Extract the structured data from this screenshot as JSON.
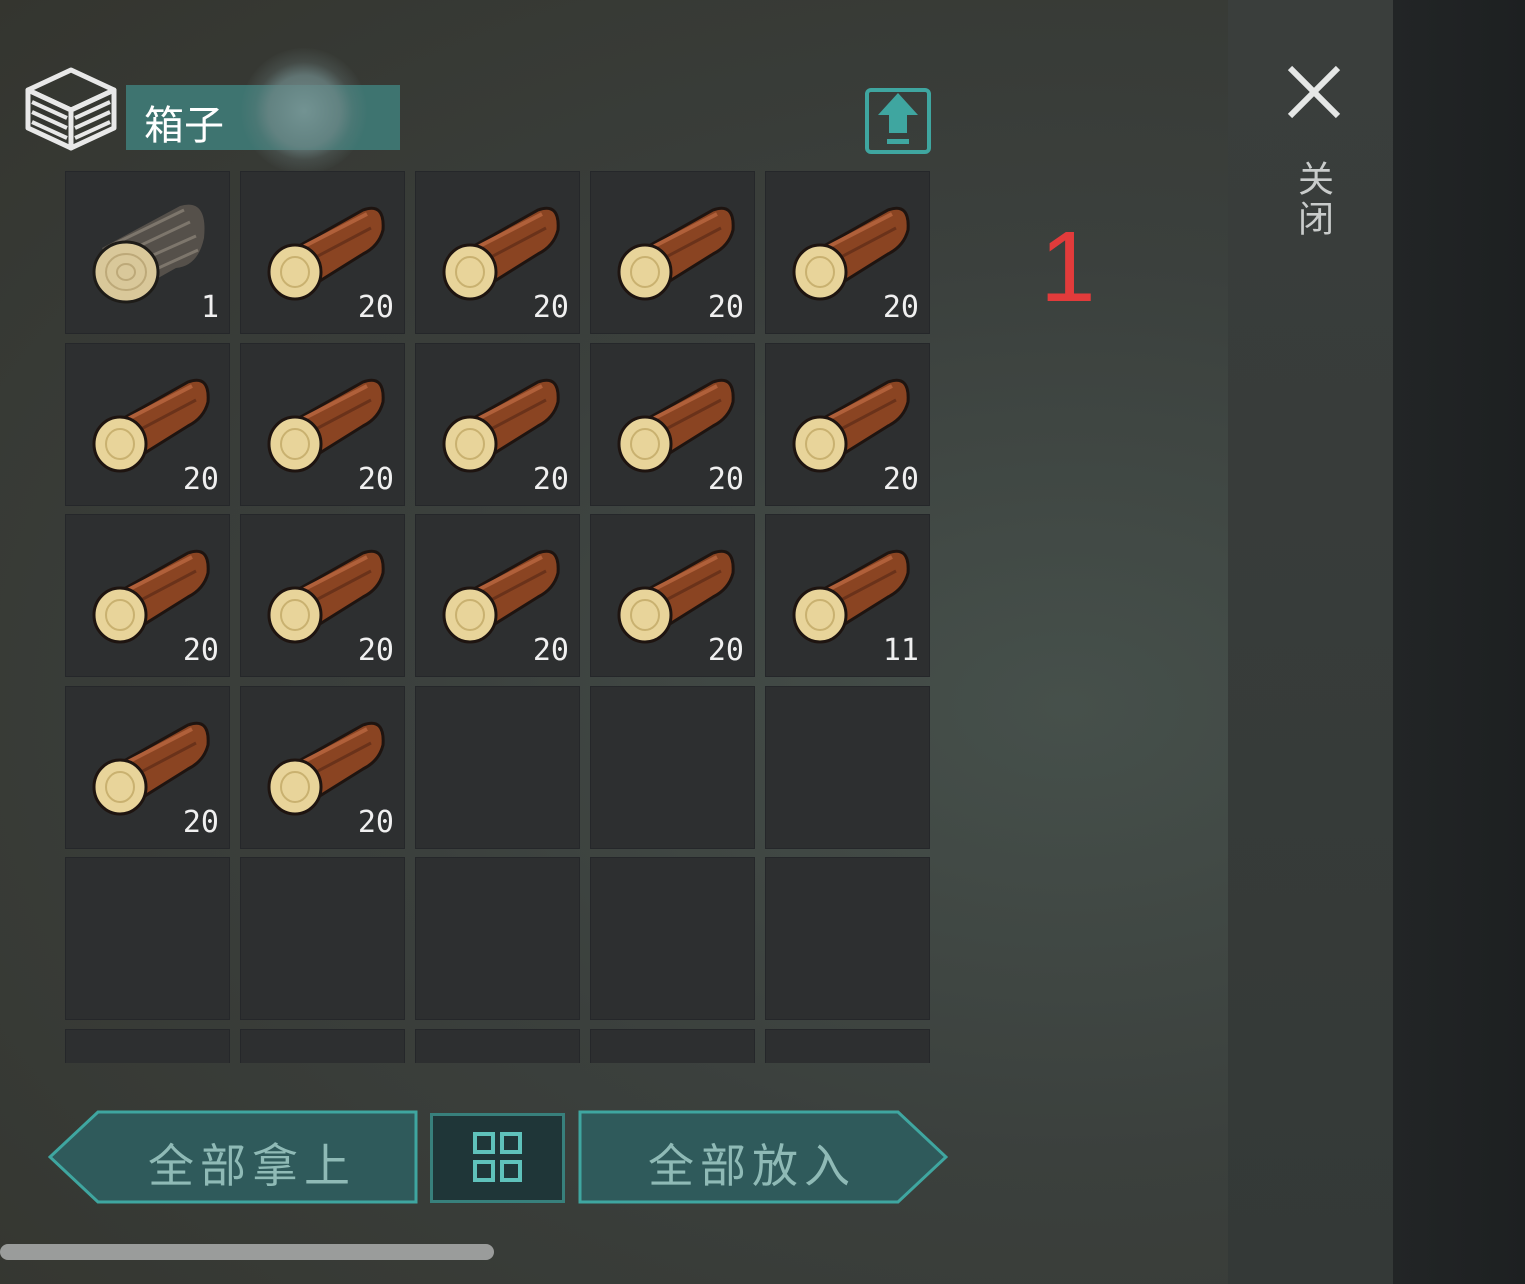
{
  "header": {
    "title": "箱子",
    "box_icon": "storage-box-icon",
    "export_icon": "upload-arrow-icon"
  },
  "sidebar": {
    "close_label": "关闭",
    "close_icon": "close-x-icon"
  },
  "annotation": "1",
  "inventory": {
    "columns": 5,
    "slots": [
      {
        "item": "log",
        "qty": "1"
      },
      {
        "item": "wood",
        "qty": "20"
      },
      {
        "item": "wood",
        "qty": "20"
      },
      {
        "item": "wood",
        "qty": "20"
      },
      {
        "item": "wood",
        "qty": "20"
      },
      {
        "item": "wood",
        "qty": "20"
      },
      {
        "item": "wood",
        "qty": "20"
      },
      {
        "item": "wood",
        "qty": "20"
      },
      {
        "item": "wood",
        "qty": "20"
      },
      {
        "item": "wood",
        "qty": "20"
      },
      {
        "item": "wood",
        "qty": "20"
      },
      {
        "item": "wood",
        "qty": "20"
      },
      {
        "item": "wood",
        "qty": "20"
      },
      {
        "item": "wood",
        "qty": "20"
      },
      {
        "item": "wood",
        "qty": "11"
      },
      {
        "item": "wood",
        "qty": "20"
      },
      {
        "item": "wood",
        "qty": "20"
      },
      {
        "item": null,
        "qty": ""
      },
      {
        "item": null,
        "qty": ""
      },
      {
        "item": null,
        "qty": ""
      },
      {
        "item": null,
        "qty": ""
      },
      {
        "item": null,
        "qty": ""
      },
      {
        "item": null,
        "qty": ""
      },
      {
        "item": null,
        "qty": ""
      },
      {
        "item": null,
        "qty": ""
      },
      {
        "item": null,
        "qty": ""
      },
      {
        "item": null,
        "qty": ""
      },
      {
        "item": null,
        "qty": ""
      },
      {
        "item": null,
        "qty": ""
      },
      {
        "item": null,
        "qty": ""
      }
    ]
  },
  "footer": {
    "take_all_label": "全部拿上",
    "put_all_label": "全部放入",
    "sort_icon": "sort-grid-icon"
  },
  "colors": {
    "accent": "#3e7470",
    "button_text": "#8fbab6",
    "annotation": "#e23b3b"
  }
}
